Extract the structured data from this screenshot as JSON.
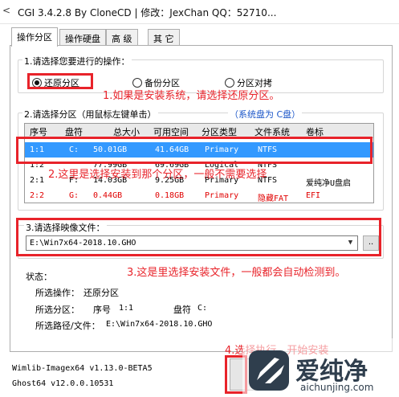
{
  "window": {
    "title": "CGI 3.4.2.8 By CloneCD | 修改：JexChan QQ：52710..."
  },
  "tabs": [
    {
      "label": "操作分区",
      "active": true
    },
    {
      "label": "操作硬盘",
      "active": false
    },
    {
      "label": "高 级",
      "active": false
    },
    {
      "label": "其 它",
      "active": false
    }
  ],
  "operation": {
    "label": "1.请选择您要进行的操作：",
    "options": [
      {
        "label": "还原分区",
        "checked": true
      },
      {
        "label": "备份分区",
        "checked": false
      },
      {
        "label": "分区对拷",
        "checked": false
      }
    ]
  },
  "partition": {
    "label": "2.请选择分区（用鼠标左键单击）",
    "disk_link": "（系统盘为 C盘）",
    "columns": [
      "序号",
      "盘符",
      "总大小",
      "可用空间",
      "分区类型",
      "文件系统",
      "卷标"
    ],
    "rows": [
      {
        "index": "1:1",
        "drive": "C:",
        "total": "50.01GB",
        "free": "41.64GB",
        "type": "Primary",
        "fs": "NTFS",
        "vol": ""
      },
      {
        "index": "1:2",
        "drive": "",
        "total": "77.99GB",
        "free": "69.69GB",
        "type": "Logical",
        "fs": "NTFS",
        "vol": ""
      },
      {
        "index": "2:1",
        "drive": "F:",
        "total": "14.03GB",
        "free": "9.25GB",
        "type": "Primary",
        "fs": "NTFS",
        "vol": "爱纯净U盘启"
      },
      {
        "index": "2:2",
        "drive": "G:",
        "total": "0.44GB",
        "free": "0.18GB",
        "type": "Primary",
        "fs": "隐藏FAT",
        "vol": "EFI"
      }
    ]
  },
  "image_file": {
    "label": "3.请选择映像文件：",
    "value": "E:\\Win7x64-2018.10.GHO",
    "browse": ".."
  },
  "status": {
    "title": "状态：",
    "op_label": "所选操作：",
    "op_value": "还原分区",
    "part_label": "所选分区：",
    "seq_label": "序号",
    "seq_value": "1:1",
    "drive_label": "盘符",
    "drive_value": "C:",
    "path_label": "所选路径/文件：",
    "path_value": "E:\\Win7x64-2018.10.GHO"
  },
  "footer": {
    "line1": "Wimlib-Imagex64 v1.13.0-BETA5",
    "line2": "Ghost64 v12.0.0.10531"
  },
  "annotations": {
    "a1": "1.如果是安装系统，请选择还原分区。",
    "a2": "2.这里是选择安装到那个分区，一般不需要选择",
    "a3": "3.这是里选择安装文件，一般都会自动检测到。",
    "a4": "4.选择执行，开始安装"
  },
  "watermark": {
    "brand": "爱纯净",
    "url": "aichunjing.com"
  },
  "colors": {
    "annotation_red": "#e8232a",
    "selection_blue": "#3399ff",
    "link_blue": "#1a55c8"
  }
}
